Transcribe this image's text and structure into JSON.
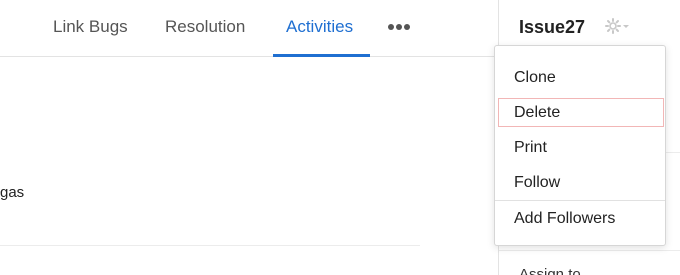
{
  "tabs": [
    {
      "label": "Link Bugs",
      "active": false
    },
    {
      "label": "Resolution",
      "active": false
    },
    {
      "label": "Activities",
      "active": true
    }
  ],
  "more_icon": "more-horizontal-icon",
  "main": {
    "partial_text": "gas"
  },
  "side_panel": {
    "title": "Issue27",
    "settings_icon": "gear-icon",
    "partial_label": "Assign to"
  },
  "dropdown": {
    "items": [
      {
        "label": "Clone"
      },
      {
        "label": "Delete",
        "highlighted": true
      },
      {
        "label": "Print"
      },
      {
        "label": "Follow"
      },
      {
        "label": "Add Followers"
      }
    ]
  },
  "colors": {
    "accent": "#1f6fd1",
    "hover_border": "#f2b6b6"
  }
}
